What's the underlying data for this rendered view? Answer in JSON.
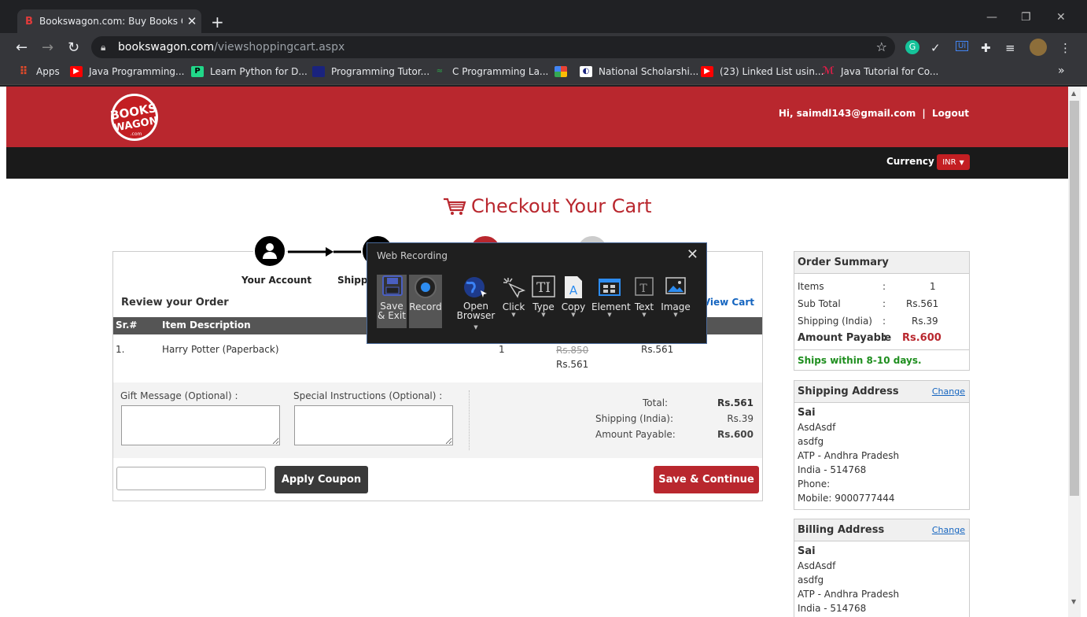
{
  "browser": {
    "tab_title": "Bookswagon.com: Buy Books On",
    "tab_favicon": "B",
    "url_host": "bookswagon.com",
    "url_path": "/viewshoppingcart.aspx",
    "bookmarks": [
      {
        "label": "Apps",
        "icon": "apps-grid-icon",
        "color": "#e34a2a"
      },
      {
        "label": "Java Programming...",
        "icon": "youtube-icon",
        "color": "#ff0000"
      },
      {
        "label": "Learn Python for D...",
        "icon": "pycharm-icon",
        "color": "#21d789"
      },
      {
        "label": "Programming Tutor...",
        "icon": "site-icon",
        "color": "#1a237e"
      },
      {
        "label": "C Programming La...",
        "icon": "gfg-icon",
        "color": "#2f8d46"
      },
      {
        "label": "",
        "icon": "pinwheel-icon",
        "color": "#fbbc05"
      },
      {
        "label": "National Scholarshi...",
        "icon": "scholarship-icon",
        "color": "#ffffff"
      },
      {
        "label": "(23) Linked List usin...",
        "icon": "youtube-icon",
        "color": "#ff0000"
      },
      {
        "label": "Java Tutorial for Co...",
        "icon": "java-icon",
        "color": "#e11d48"
      }
    ],
    "bookmarks_more": "»"
  },
  "header": {
    "logo_text": "BOOKS WAGON",
    "logo_sub": ".com",
    "user_text": "Hi, saimdl143@gmail.com",
    "separator": "|",
    "logout": "Logout",
    "currency_label": "Currency",
    "currency_value": "INR"
  },
  "checkout": {
    "title": "Checkout Your Cart",
    "steps": [
      {
        "label": "Your Account"
      },
      {
        "label": "Shipp"
      }
    ],
    "review_title": "Review your Order",
    "view_cart": "View Cart",
    "columns": [
      "Sr.#",
      "Item Description"
    ],
    "rows": [
      {
        "sr": "1.",
        "item": "Harry Potter (Paperback)",
        "qty": "1",
        "mrp": "Rs.850",
        "price": "Rs.561",
        "total": "Rs.561"
      }
    ],
    "gift_label": "Gift Message (Optional) :",
    "instructions_label": "Special Instructions (Optional) :",
    "totals": [
      {
        "label": "Total:",
        "value": "Rs.561"
      },
      {
        "label": "Shipping (India):",
        "value": "Rs.39"
      },
      {
        "label": "Amount Payable:",
        "value": "Rs.600"
      }
    ],
    "coupon_placeholder": "",
    "apply_coupon": "Apply Coupon",
    "save_continue": "Save & Continue"
  },
  "order_summary": {
    "title": "Order Summary",
    "rows": [
      {
        "label": "Items",
        "colon": ":",
        "value": "1"
      },
      {
        "label": "Sub Total",
        "colon": ":",
        "value": "Rs.561"
      },
      {
        "label": "Shipping (India)",
        "colon": ":",
        "value": "Rs.39"
      }
    ],
    "payable_label": "Amount Payable",
    "payable_colon": ":",
    "payable_value": "Rs.600",
    "ships": "Ships within 8-10 days."
  },
  "shipping_address": {
    "title": "Shipping Address",
    "change": "Change",
    "name": "Sai",
    "lines": [
      "AsdAsdf",
      "asdfg",
      "ATP - Andhra Pradesh",
      "India - 514768",
      "Phone:",
      "Mobile: 9000777444"
    ]
  },
  "billing_address": {
    "title": "Billing Address",
    "change": "Change",
    "name": "Sai",
    "lines": [
      "AsdAsdf",
      "asdfg",
      "ATP - Andhra Pradesh",
      "India - 514768"
    ]
  },
  "web_recording": {
    "title": "Web Recording",
    "buttons": [
      {
        "label": "Save & Exit",
        "icon": "save-icon"
      },
      {
        "label": "Record",
        "icon": "record-icon"
      },
      {
        "label": "Open Browser",
        "icon": "globe-icon"
      },
      {
        "label": "Click",
        "icon": "click-icon"
      },
      {
        "label": "Type",
        "icon": "type-icon"
      },
      {
        "label": "Copy",
        "icon": "copy-icon"
      },
      {
        "label": "Element",
        "icon": "element-icon"
      },
      {
        "label": "Text",
        "icon": "text-icon"
      },
      {
        "label": "Image",
        "icon": "image-icon"
      }
    ]
  },
  "colors": {
    "brand_red": "#b9272e",
    "header_dark": "#1a1a1a",
    "link_blue": "#1565c0",
    "ships_green": "#1e8e1e"
  }
}
